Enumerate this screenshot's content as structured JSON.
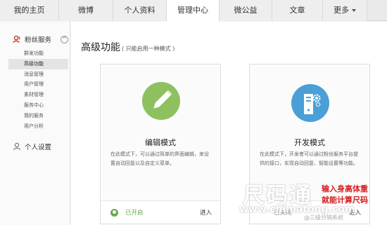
{
  "tabs": [
    {
      "label": "我的主页",
      "active": false
    },
    {
      "label": "微博",
      "active": false
    },
    {
      "label": "个人资料",
      "active": false
    },
    {
      "label": "管理中心",
      "active": true
    },
    {
      "label": "微公益",
      "active": false
    },
    {
      "label": "文章",
      "active": false
    },
    {
      "label": "更多",
      "active": false
    }
  ],
  "sidebar": {
    "section_title": "粉丝服务",
    "items": [
      {
        "label": "群发功能",
        "active": false
      },
      {
        "label": "高级功能",
        "active": true
      },
      {
        "label": "消息管理",
        "active": false
      },
      {
        "label": "用户管理",
        "active": false
      },
      {
        "label": "素材管理",
        "active": false
      },
      {
        "label": "服务中心",
        "active": false
      },
      {
        "label": "我的服务",
        "active": false
      },
      {
        "label": "用户分析",
        "active": false
      }
    ],
    "settings_label": "个人设置"
  },
  "main": {
    "title": "高级功能",
    "subtitle": "( 只能启用一种模式 )",
    "cards": [
      {
        "title": "编辑模式",
        "description": "在此模式下，可以通过简单的界面编辑，来设置自动回复以及自定义菜单。",
        "status": "已开启",
        "action": "进入",
        "icon": "pencil-icon",
        "color": "#8ec060"
      },
      {
        "title": "开发模式",
        "description": "在此模式下，开发者可以通过粉丝服务平台提供的接口，实现自动回复、智能设置等功能。",
        "status": "已关闭",
        "action": "进入",
        "icon": "server-gear-icon",
        "color": "#4a9fd6"
      }
    ]
  },
  "watermark": {
    "logo": "尺码通",
    "red_line1": "输入身高体重",
    "red_line2": "就能计算尺码",
    "url": "www.chimatong.com",
    "signature": "@三级分销系统"
  }
}
